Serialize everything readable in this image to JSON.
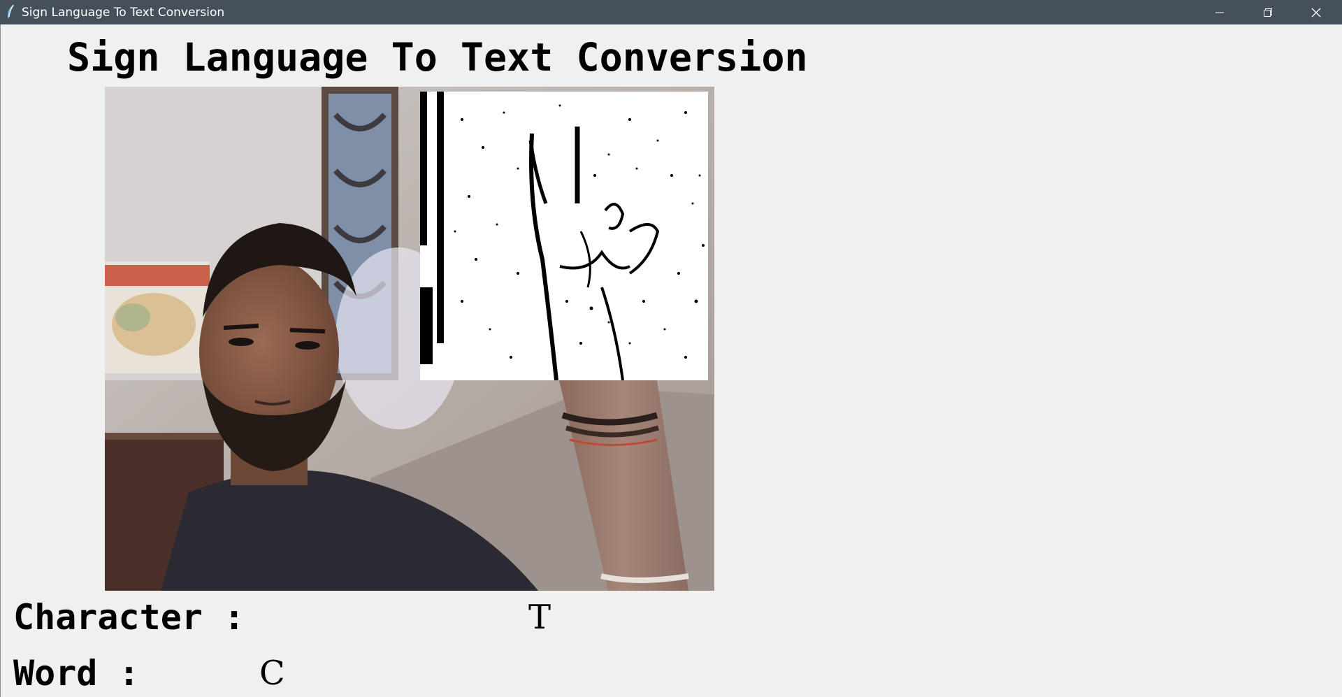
{
  "window": {
    "title": "Sign Language To Text Conversion",
    "app_icon": "feather-icon",
    "controls": {
      "minimize_icon": "minimize-icon",
      "restore_icon": "restore-icon",
      "close_icon": "close-icon"
    },
    "titlebar_color": "#46505a"
  },
  "main": {
    "heading": "Sign Language To Text Conversion",
    "camera_feed": "webcam-feed",
    "threshold_view": "hand-threshold-view",
    "character": {
      "label": "Character :",
      "value": "T"
    },
    "word": {
      "label": "Word :",
      "value": "C"
    }
  },
  "colors": {
    "background": "#f0f0f0",
    "text": "#000000"
  }
}
